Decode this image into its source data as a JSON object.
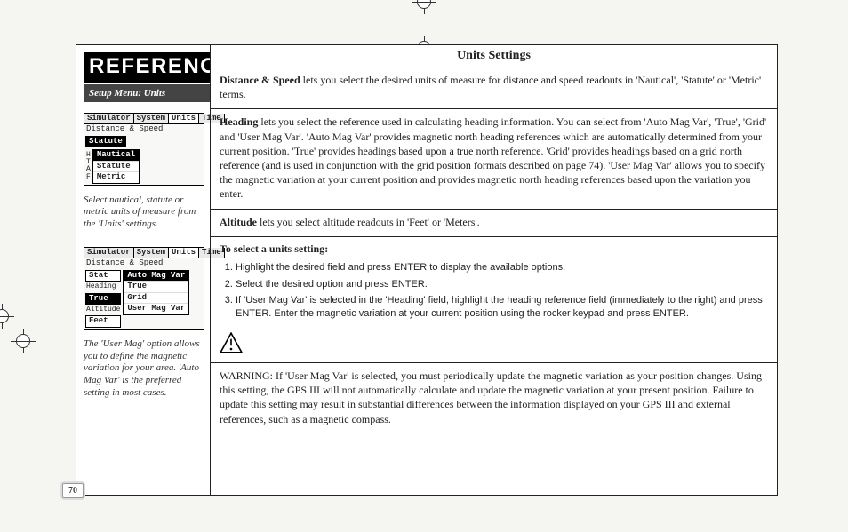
{
  "header": {
    "title": "REFERENCE",
    "submenu": "Setup Menu: Units"
  },
  "page_number": "70",
  "left": {
    "screenshot1": {
      "tabs": [
        "Simulator",
        "System",
        "Units",
        "Time"
      ],
      "row_label": "Distance & Speed",
      "selected": "Statute",
      "menu": [
        "Nautical",
        "Statute",
        "Metric"
      ],
      "side_labels": [
        "H",
        "T",
        "A",
        "F"
      ]
    },
    "caption1": "Select nautical, statute or metric units of measure from the 'Units' settings.",
    "screenshot2": {
      "tabs": [
        "Simulator",
        "System",
        "Units",
        "Time"
      ],
      "rows": {
        "distance_label": "Distance & Speed",
        "distance_value": "Stat",
        "heading_label": "Heading",
        "heading_value": "True",
        "altitude_label": "Altitude",
        "altitude_value": "Feet"
      },
      "menu": [
        "Auto Mag Var",
        "True",
        "Grid",
        "User Mag Var"
      ]
    },
    "caption2": "The 'User Mag' option allows you to define the magnetic variation for your area. 'Auto Mag Var' is the preferred setting in most cases."
  },
  "right": {
    "section_title": "Units Settings",
    "distance_lead": "Distance & Speed",
    "distance_text": " lets you select the desired units of measure for distance and speed readouts in 'Nautical', 'Statute' or 'Metric' terms.",
    "heading_lead": "Heading",
    "heading_text": " lets you select the reference used in calculating heading information. You can select from 'Auto Mag Var', 'True', 'Grid' and 'User Mag Var'. 'Auto Mag Var' provides magnetic north heading references which are automatically determined from your current position. 'True' provides headings based upon a true north reference. 'Grid' provides headings based on a grid north reference (and is used in conjunction with the grid position formats described on page 74). 'User Mag Var' allows you to specify the magnetic variation at your current position and provides magnetic north heading references based upon the variation you enter.",
    "altitude_lead": "Altitude",
    "altitude_text": " lets you select altitude readouts in 'Feet' or 'Meters'.",
    "steps_head": "To select a units setting:",
    "steps": [
      "Highlight the desired field and press ENTER to display the available options.",
      "Select the desired option and press ENTER.",
      "If 'User Mag Var' is selected in the 'Heading' field, highlight the heading reference field (immediately to the right) and press ENTER. Enter the magnetic variation at your current position using the rocker keypad and press ENTER."
    ],
    "warning": "WARNING: If 'User Mag Var' is selected, you must periodically update the magnetic variation as your position changes. Using this setting, the GPS III will not automatically calculate and update the magnetic variation at your present position. Failure to update this setting may result in substantial differences between the information displayed on your GPS III and external references, such as a magnetic compass."
  }
}
